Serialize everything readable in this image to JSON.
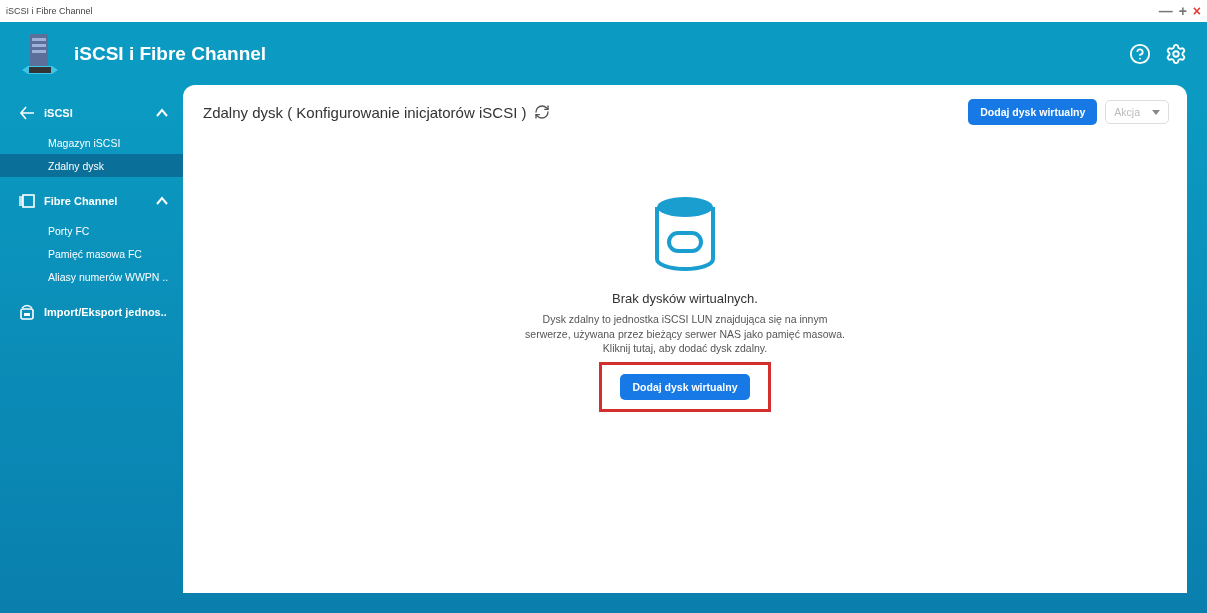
{
  "window": {
    "title": "iSCSI i Fibre Channel",
    "controls": [
      "—",
      "+",
      "×"
    ]
  },
  "header": {
    "title": "iSCSI i Fibre Channel"
  },
  "sidebar": {
    "groups": [
      {
        "label": "iSCSI",
        "kind": "iscsi",
        "expanded": true,
        "children": [
          {
            "label": "Magazyn iSCSI",
            "selected": false
          },
          {
            "label": "Zdalny dysk",
            "selected": true
          }
        ]
      },
      {
        "label": "Fibre Channel",
        "kind": "fc",
        "expanded": true,
        "children": [
          {
            "label": "Porty FC",
            "selected": false
          },
          {
            "label": "Pamięć masowa FC",
            "selected": false
          },
          {
            "label": "Aliasy numerów WWPN ..",
            "selected": false
          }
        ]
      },
      {
        "label": "Import/Eksport jednos..",
        "kind": "import"
      }
    ]
  },
  "content": {
    "title": "Zdalny dysk ( Konfigurowanie inicjatorów iSCSI )",
    "toolbar": {
      "add_button": "Dodaj dysk wirtualny",
      "action_dropdown": {
        "label": "Akcja",
        "disabled": true
      }
    },
    "empty_state": {
      "heading": "Brak dysków wirtualnych.",
      "description": "Dysk zdalny to jednostka iSCSI LUN znajdująca się na innym serwerze, używana przez bieżący serwer NAS jako pamięć masowa. Kliknij tutaj, aby dodać dysk zdalny.",
      "button": "Dodaj dysk wirtualny",
      "highlighted": true
    }
  }
}
